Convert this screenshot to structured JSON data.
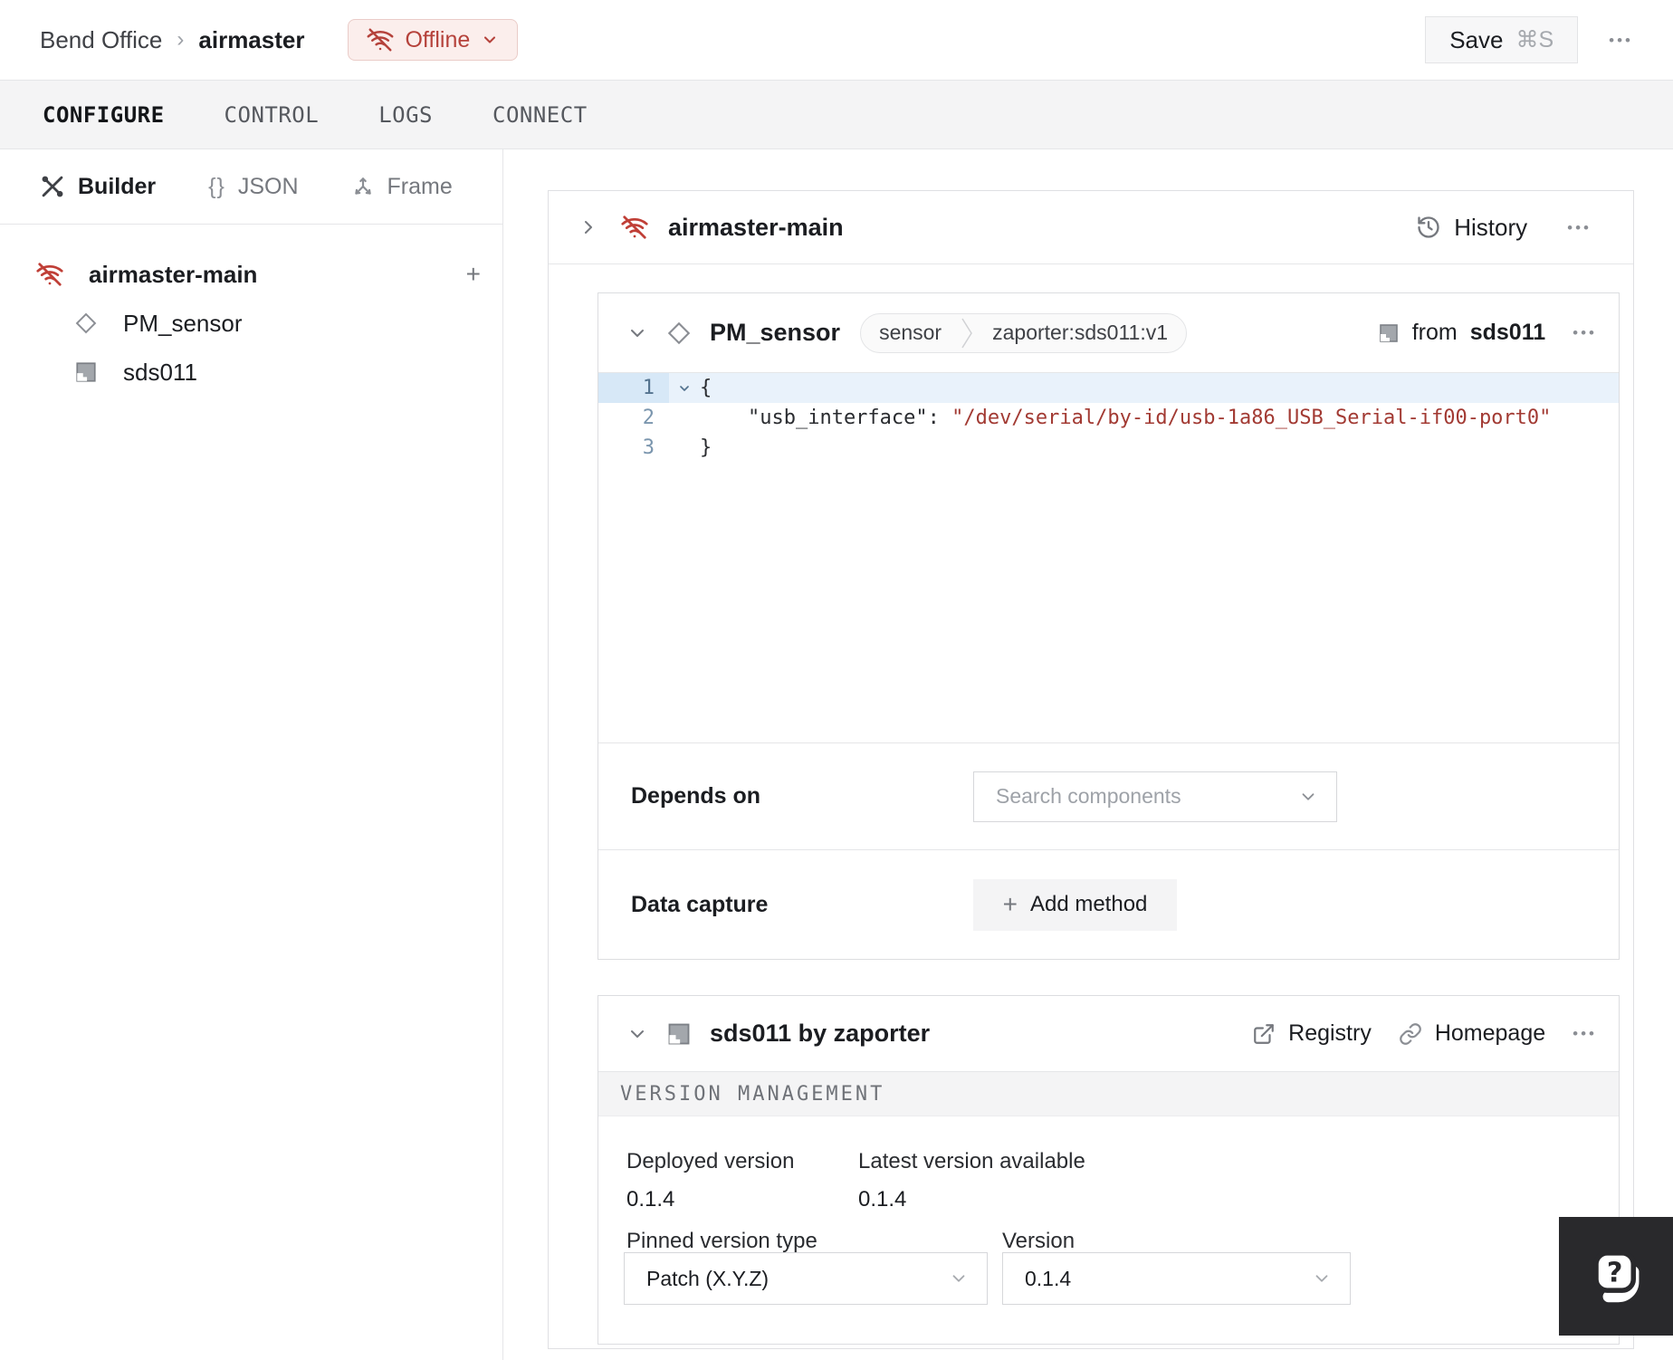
{
  "topbar": {
    "breadcrumb": {
      "org": "Bend Office",
      "separator": "›",
      "machine": "airmaster"
    },
    "status_badge": {
      "label": "Offline"
    },
    "save_button": {
      "label": "Save",
      "shortcut": "⌘S"
    },
    "overflow": "•••"
  },
  "tabs": [
    {
      "label": "CONFIGURE",
      "active": true
    },
    {
      "label": "CONTROL",
      "active": false
    },
    {
      "label": "LOGS",
      "active": false
    },
    {
      "label": "CONNECT",
      "active": false
    }
  ],
  "sidebar": {
    "modes": [
      {
        "label": "Builder",
        "active": true
      },
      {
        "label": "JSON",
        "active": false
      },
      {
        "label": "Frame",
        "active": false
      }
    ],
    "json_glyph": "{}",
    "tree": {
      "root": {
        "label": "airmaster-main"
      },
      "add_button": "+",
      "children": [
        {
          "label": "PM_sensor"
        },
        {
          "label": "sds011"
        }
      ]
    }
  },
  "part_card": {
    "title": "airmaster-main",
    "history": {
      "label": "History"
    },
    "overflow": "•••"
  },
  "component_card": {
    "title": "PM_sensor",
    "type_badge": {
      "type": "sensor",
      "model": "zaporter:sds011:v1"
    },
    "from_module": {
      "prefix": "from",
      "name": "sds011"
    },
    "editor": {
      "lines": [
        {
          "num": "1",
          "text": "{"
        },
        {
          "num": "2",
          "key": "    \"usb_interface\": ",
          "value": "\"/dev/serial/by-id/usb-1a86_USB_Serial-if00-port0\""
        },
        {
          "num": "3",
          "text": "}"
        }
      ]
    },
    "depends_on": {
      "label": "Depends on",
      "placeholder": "Search components"
    },
    "data_capture": {
      "label": "Data capture",
      "add_button": "Add method"
    },
    "overflow": "•••"
  },
  "module_card": {
    "title": "sds011 by zaporter",
    "registry_link": {
      "label": "Registry"
    },
    "homepage_link": {
      "label": "Homepage"
    },
    "overflow": "•••",
    "version_section": {
      "heading": "VERSION MANAGEMENT",
      "deployed": {
        "label": "Deployed version",
        "value": "0.1.4"
      },
      "latest": {
        "label": "Latest version available",
        "value": "0.1.4"
      },
      "pinned_type": {
        "label": "Pinned version type",
        "value": "Patch (X.Y.Z)"
      },
      "version": {
        "label": "Version",
        "value": "0.1.4"
      }
    }
  },
  "colors": {
    "accent_red": "#b5423b",
    "code_string_red": "#a23a33",
    "active_line_bg": "#e9f2fb",
    "tabbar_bg": "#f4f4f5",
    "help_widget_bg": "#29292c"
  }
}
